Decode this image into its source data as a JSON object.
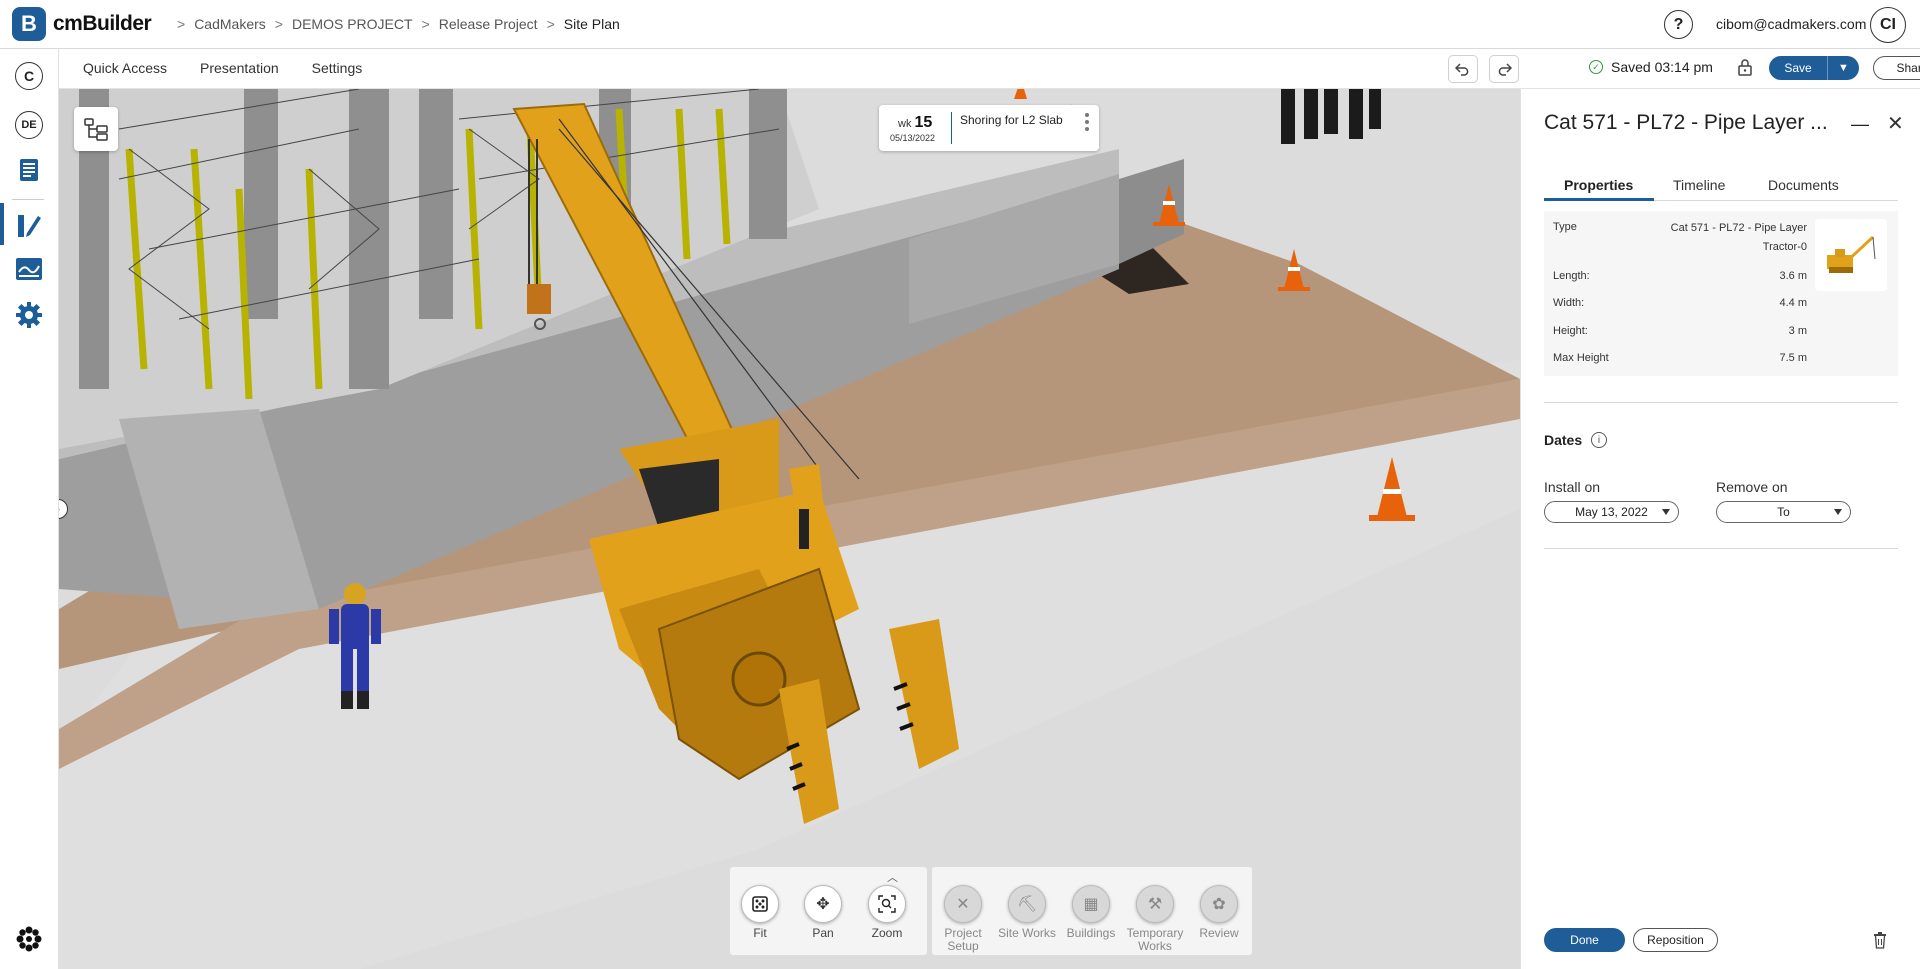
{
  "app": {
    "logo_letter": "B",
    "name": "cmBuilder"
  },
  "breadcrumb": [
    "CadMakers",
    "DEMOS PROJECT",
    "Release Project",
    "Site Plan"
  ],
  "header": {
    "help": "?",
    "user_email": "cibom@cadmakers.com",
    "user_initials": "CI"
  },
  "rail": {
    "company": "C",
    "language": "DE"
  },
  "toolbar": {
    "menu": [
      "Quick Access",
      "Presentation",
      "Settings"
    ],
    "saved_text": "Saved 03:14 pm",
    "save_label": "Save",
    "share_label": "Share"
  },
  "viewport": {
    "week_prefix": "wk",
    "week_number": "15",
    "week_date": "05/13/2022",
    "task": "Shoring for L2 Slab"
  },
  "nav_dock": [
    {
      "label": "Fit",
      "icon": "fit-icon"
    },
    {
      "label": "Pan",
      "icon": "pan-icon"
    },
    {
      "label": "Zoom",
      "icon": "zoom-icon"
    }
  ],
  "category_dock": [
    {
      "label": "Project Setup",
      "icon": "project-setup-icon"
    },
    {
      "label": "Site Works",
      "icon": "site-works-icon"
    },
    {
      "label": "Buildings",
      "icon": "buildings-icon"
    },
    {
      "label": "Temporary Works",
      "icon": "temporary-works-icon"
    },
    {
      "label": "Review",
      "icon": "review-icon"
    }
  ],
  "panel": {
    "title": "Cat 571 - PL72 - Pipe Layer ...",
    "tabs": [
      "Properties",
      "Timeline",
      "Documents"
    ],
    "active_tab": "Properties",
    "type_label": "Type",
    "type_value_line1": "Cat 571 - PL72 - Pipe Layer",
    "type_value_line2": "Tractor-0",
    "properties": [
      {
        "label": "Length:",
        "value": "3.6 m"
      },
      {
        "label": "Width:",
        "value": "4.4 m"
      },
      {
        "label": "Height:",
        "value": "3 m"
      },
      {
        "label": "Max Height",
        "value": "7.5 m"
      }
    ],
    "dates_label": "Dates",
    "install_label": "Install on",
    "install_value": "May 13, 2022",
    "remove_label": "Remove on",
    "remove_value": "To",
    "done_label": "Done",
    "reposition_label": "Reposition"
  },
  "colors": {
    "accent": "#1f5d99",
    "equipment": "#e2a11a",
    "ground": "#b7967a"
  }
}
